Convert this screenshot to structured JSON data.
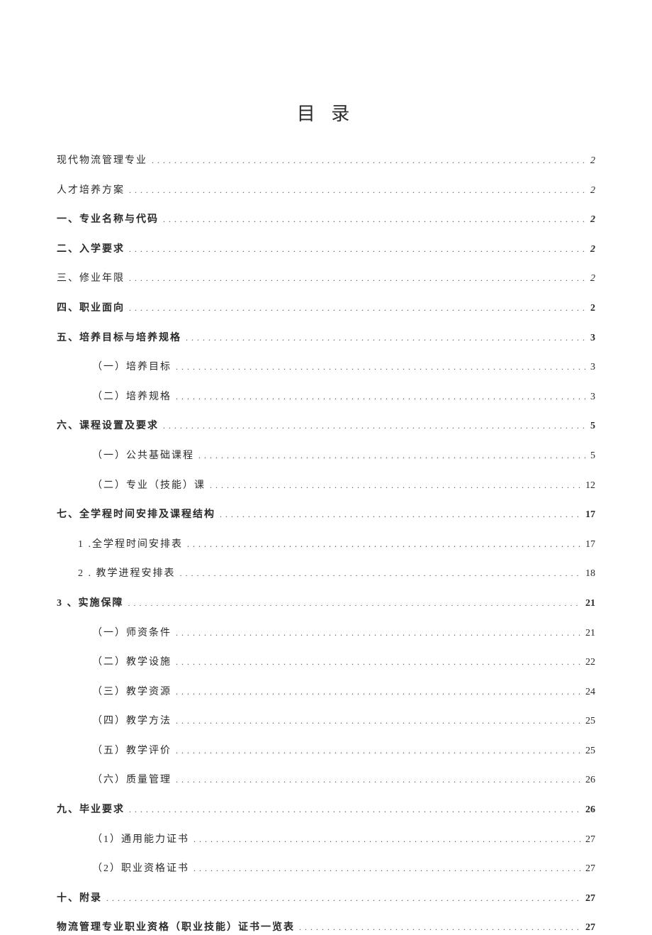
{
  "title": "目 录",
  "entries": [
    {
      "label": "现代物流管理专业",
      "page": "2",
      "indent": 0,
      "bold": false,
      "italic": true
    },
    {
      "label": "人才培养方案",
      "page": "2",
      "indent": 0,
      "bold": false,
      "italic": true
    },
    {
      "label": "一、专业名称与代码",
      "page": "2",
      "indent": 0,
      "bold": true,
      "italic": true
    },
    {
      "label": "二、入学要求",
      "page": "2",
      "indent": 0,
      "bold": true,
      "italic": true
    },
    {
      "label": "三、修业年限",
      "page": "2",
      "indent": 0,
      "bold": false,
      "italic": true
    },
    {
      "label": "四、职业面向",
      "page": "2",
      "indent": 0,
      "bold": true,
      "italic": false
    },
    {
      "label": "五、培养目标与培养规格",
      "page": "3",
      "indent": 0,
      "bold": true,
      "italic": false
    },
    {
      "label": "（一）培养目标",
      "page": "3",
      "indent": 1,
      "bold": false,
      "italic": false
    },
    {
      "label": "（二）培养规格",
      "page": "3",
      "indent": 1,
      "bold": false,
      "italic": false
    },
    {
      "label": "六、课程设置及要求",
      "page": "5",
      "indent": 0,
      "bold": true,
      "italic": false
    },
    {
      "label": "（一）公共基础课程",
      "page": "5",
      "indent": 1,
      "bold": false,
      "italic": false
    },
    {
      "label": "（二）专业（技能）课",
      "page": "12",
      "indent": 1,
      "bold": false,
      "italic": false
    },
    {
      "label": "七、全学程时间安排及课程结构",
      "page": "17",
      "indent": 0,
      "bold": true,
      "italic": false
    },
    {
      "label": "1 .全学程时间安排表",
      "page": "17",
      "indent": 2,
      "bold": false,
      "italic": false
    },
    {
      "label": "2  . 教学进程安排表",
      "page": "18",
      "indent": 2,
      "bold": false,
      "italic": false
    },
    {
      "label": "3   、实施保障",
      "page": "21",
      "indent": 0,
      "bold": true,
      "italic": false
    },
    {
      "label": "（一）师资条件",
      "page": "21",
      "indent": 1,
      "bold": false,
      "italic": false
    },
    {
      "label": "（二）教学设施",
      "page": "22",
      "indent": 1,
      "bold": false,
      "italic": false
    },
    {
      "label": "（三）教学资源",
      "page": "24",
      "indent": 1,
      "bold": false,
      "italic": false
    },
    {
      "label": "（四）教学方法",
      "page": "25",
      "indent": 1,
      "bold": false,
      "italic": false
    },
    {
      "label": "（五）教学评价",
      "page": "25",
      "indent": 1,
      "bold": false,
      "italic": false
    },
    {
      "label": "（六）质量管理",
      "page": "26",
      "indent": 1,
      "bold": false,
      "italic": false
    },
    {
      "label": "九、毕业要求",
      "page": "26",
      "indent": 0,
      "bold": true,
      "italic": false
    },
    {
      "label": "（1）通用能力证书",
      "page": "27",
      "indent": 1,
      "bold": false,
      "italic": false
    },
    {
      "label": "（2）职业资格证书",
      "page": "27",
      "indent": 1,
      "bold": false,
      "italic": false
    },
    {
      "label": "十、附录",
      "page": "27",
      "indent": 0,
      "bold": true,
      "italic": false
    },
    {
      "label": "物流管理专业职业资格（职业技能）证书一览表",
      "page": "27",
      "indent": 0,
      "bold": true,
      "italic": false
    }
  ]
}
